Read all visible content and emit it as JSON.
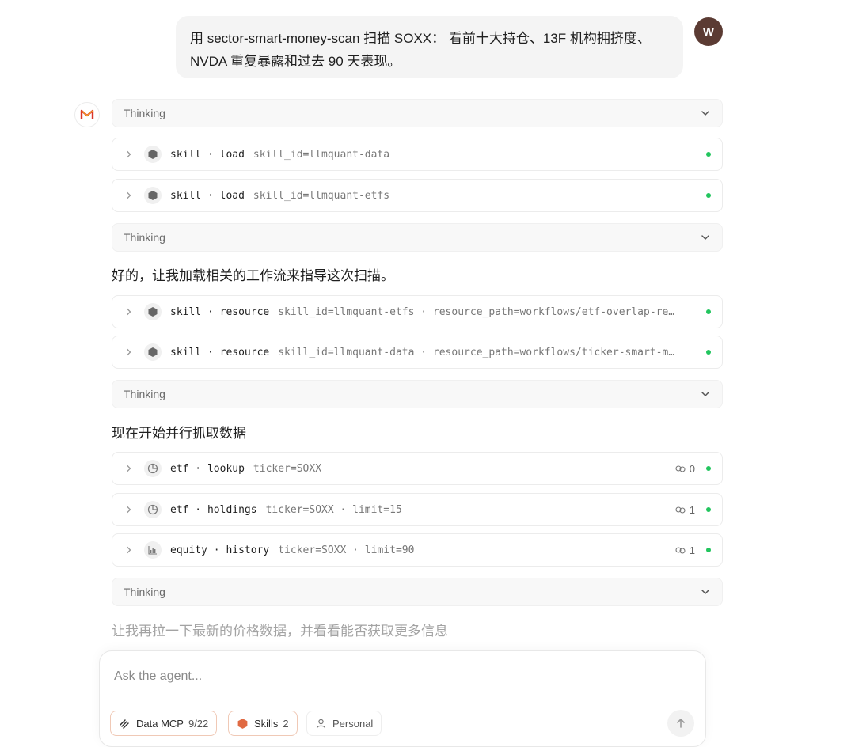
{
  "user": {
    "avatar_initial": "W",
    "message": "用 sector-smart-money-scan 扫描 SOXX： 看前十大持仓、13F 机构拥挤度、NVDA 重复暴露和过去 90 天表现。"
  },
  "thinking_label": "Thinking",
  "tools": [
    {
      "icon": "hexagon-icon",
      "name": "skill · load",
      "args": "skill_id=llmquant-data",
      "count": "",
      "status_color": "#22c55e"
    },
    {
      "icon": "hexagon-icon",
      "name": "skill · load",
      "args": "skill_id=llmquant-etfs",
      "count": "",
      "status_color": "#22c55e"
    },
    {
      "icon": "hexagon-icon",
      "name": "skill · resource",
      "args": "skill_id=llmquant-etfs · resource_path=workflows/etf-overlap-re…",
      "count": "",
      "status_color": "#22c55e"
    },
    {
      "icon": "hexagon-icon",
      "name": "skill · resource",
      "args": "skill_id=llmquant-data · resource_path=workflows/ticker-smart-m…",
      "count": "",
      "status_color": "#22c55e"
    },
    {
      "icon": "pie-chart-icon",
      "name": "etf · lookup",
      "args": "ticker=SOXX",
      "count": "0",
      "status_color": "#22c55e"
    },
    {
      "icon": "pie-chart-icon",
      "name": "etf · holdings",
      "args": "ticker=SOXX · limit=15",
      "count": "1",
      "status_color": "#22c55e"
    },
    {
      "icon": "bar-chart-icon",
      "name": "equity · history",
      "args": "ticker=SOXX · limit=90",
      "count": "1",
      "status_color": "#22c55e"
    }
  ],
  "messages": {
    "m1": "好的，让我加载相关的工作流来指导这次扫描。",
    "m2": "现在开始并行抓取数据",
    "m3": "让我再拉一下最新的价格数据，并看看能否获取更多信息"
  },
  "composer": {
    "placeholder": "Ask the agent...",
    "chips": [
      {
        "icon": "data-mcp-icon",
        "label": "Data MCP",
        "count": "9/22"
      },
      {
        "icon": "skills-hexagon-icon",
        "label": "Skills",
        "count": "2"
      },
      {
        "icon": "person-icon",
        "label": "Personal",
        "count": ""
      }
    ]
  },
  "colors": {
    "accent": "#e06a43",
    "status_ok": "#22c55e",
    "avatar_bg": "#5b3b33"
  }
}
